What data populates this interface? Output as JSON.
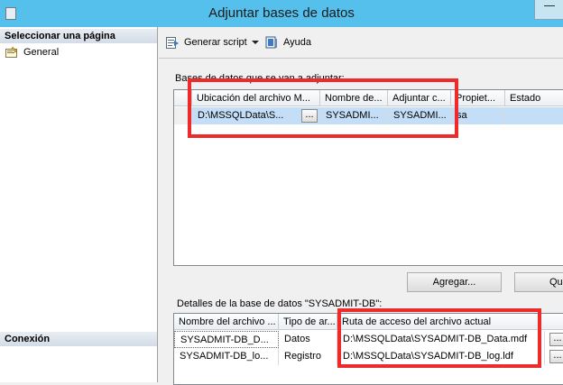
{
  "window": {
    "title": "Adjuntar bases de datos"
  },
  "sidebar": {
    "header": "Seleccionar una página",
    "items": [
      {
        "label": "General"
      }
    ],
    "connection_header": "Conexión"
  },
  "toolbar": {
    "script_label": "Generar script",
    "help_label": "Ayuda"
  },
  "attach_section": {
    "label": "Bases de datos que se van a adjuntar:",
    "columns": [
      "Ubicación del archivo M...",
      "Nombre de...",
      "Adjuntar c...",
      "Propiet...",
      "Estado"
    ],
    "rows": [
      {
        "location": "D:\\MSSQLData\\S...",
        "name": "SYSADMI...",
        "attach_as": "SYSADMI...",
        "owner": "sa",
        "status": ""
      }
    ],
    "ellipsis": "...",
    "add_button": "Agregar...",
    "remove_button": "Qui"
  },
  "details_section": {
    "label": "Detalles de la base de datos \"SYSADMIT-DB\":",
    "columns": [
      "Nombre del archivo ...",
      "Tipo de ar...",
      "Ruta de acceso del archivo actual"
    ],
    "rows": [
      {
        "file": "SYSADMIT-DB_D...",
        "type": "Datos",
        "path": "D:\\MSSQLData\\SYSADMIT-DB_Data.mdf"
      },
      {
        "file": "SYSADMIT-DB_lo...",
        "type": "Registro",
        "path": "D:\\MSSQLData\\SYSADMIT-DB_log.ldf"
      }
    ],
    "ellipsis": "..."
  },
  "colors": {
    "titlebar": "#56c0ec",
    "selection": "#c5def7",
    "highlight": "#ee2a2a"
  }
}
